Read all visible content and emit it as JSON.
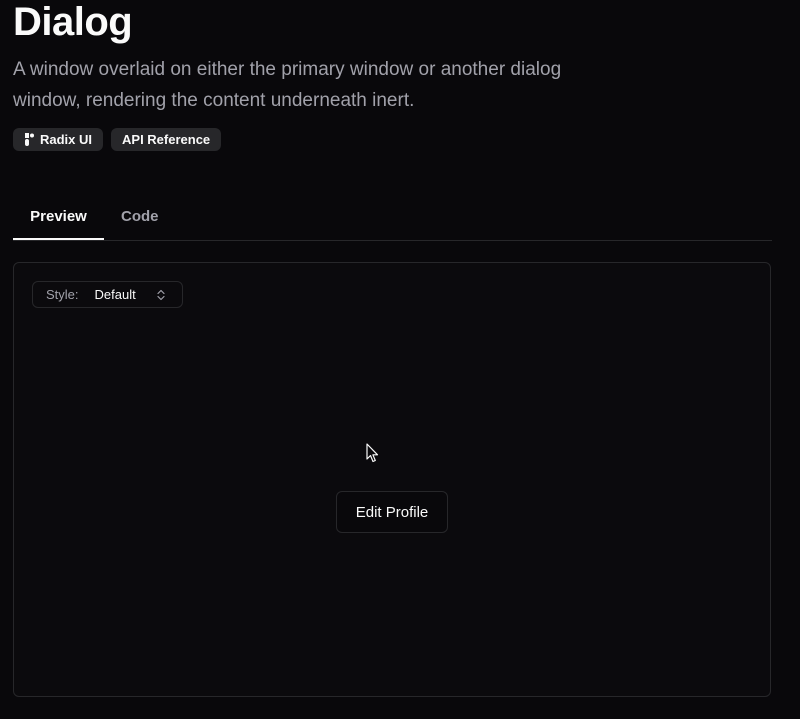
{
  "header": {
    "title": "Dialog",
    "description": "A window overlaid on either the primary window or another dialog window, rendering the content underneath inert.",
    "badges": [
      {
        "label": "Radix UI",
        "icon": "radix-icon"
      },
      {
        "label": "API Reference"
      }
    ]
  },
  "tabs": [
    {
      "label": "Preview",
      "active": true
    },
    {
      "label": "Code",
      "active": false
    }
  ],
  "preview": {
    "style_select": {
      "label": "Style:",
      "value": "Default",
      "icon": "chevron-up-down-icon"
    },
    "edit_button_label": "Edit Profile"
  },
  "colors": {
    "background": "#09080b",
    "text": "#fafafa",
    "muted_text": "#a1a1aa",
    "border": "#27272a",
    "badge_bg": "#27272a"
  }
}
